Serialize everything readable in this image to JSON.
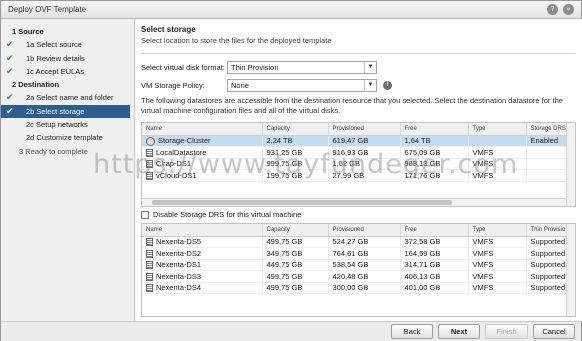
{
  "window": {
    "title": "Deploy OVF Template"
  },
  "sidebar": {
    "steps": [
      {
        "label": "1  Source",
        "kind": "head",
        "check": ""
      },
      {
        "label": "1a  Select source",
        "kind": "sub",
        "check": "✔"
      },
      {
        "label": "1b  Review details",
        "kind": "sub",
        "check": "✔"
      },
      {
        "label": "1c  Accept EULAs",
        "kind": "sub",
        "check": "✔"
      },
      {
        "label": "2  Destination",
        "kind": "head",
        "check": ""
      },
      {
        "label": "2a  Select name and folder",
        "kind": "sub",
        "check": "✔"
      },
      {
        "label": "2b  Select storage",
        "kind": "sub active",
        "check": "✔"
      },
      {
        "label": "2c  Setup networks",
        "kind": "sub",
        "check": ""
      },
      {
        "label": "2d  Customize template",
        "kind": "sub",
        "check": ""
      },
      {
        "label": "3  Ready to complete",
        "kind": "plain muted",
        "check": ""
      }
    ]
  },
  "main": {
    "title": "Select storage",
    "subtitle": "Select location to store the files for the deployed template",
    "disk_format_label": "Select virtual disk format:",
    "disk_format_value": "Thin Provision",
    "policy_label": "VM Storage Policy:",
    "policy_value": "None",
    "description": "The following datastores are accessible from the destination resource that you selected. Select the destination datastore for the virtual machine configuration files and all of the virtual disks."
  },
  "top_table": {
    "columns": [
      "Name",
      "Capacity",
      "Provisioned",
      "Free",
      "Type",
      "Storage DRS"
    ],
    "rows": [
      {
        "icon": "cluster",
        "name": "Storage-Cluster",
        "capacity": "2,24 TB",
        "provisioned": "619,47 GB",
        "free": "1,64 TB",
        "type": "",
        "drs": "Enabled"
      },
      {
        "icon": "datastore",
        "name": "LocalDatastore",
        "capacity": "931,25 GB",
        "provisioned": "916,93 GB",
        "free": "675,09 GB",
        "type": "VMFS",
        "drs": ""
      },
      {
        "icon": "datastore",
        "name": "Clrap-DS1",
        "capacity": "999,75 GB",
        "provisioned": "1,62 GB",
        "free": "988,13 GB",
        "type": "VMFS",
        "drs": ""
      },
      {
        "icon": "datastore",
        "name": "vCloud-DS1",
        "capacity": "199,75 GB",
        "provisioned": "27,99 GB",
        "free": "171,76 GB",
        "type": "VMFS",
        "drs": ""
      }
    ]
  },
  "drs_checkbox_label": "Disable Storage DRS for this virtual machine",
  "bottom_table": {
    "columns": [
      "Name",
      "Capacity",
      "Provisioned",
      "Free",
      "Type",
      "Thin Provisio"
    ],
    "rows": [
      {
        "name": "Nexenta-DS5",
        "capacity": "499,75 GB",
        "provisioned": "524,27 GB",
        "free": "372,58 GB",
        "type": "VMFS",
        "thin": "Supported"
      },
      {
        "name": "Nexenta-DS2",
        "capacity": "349,75 GB",
        "provisioned": "764,61 GB",
        "free": "164,59 GB",
        "type": "VMFS",
        "thin": "Supported"
      },
      {
        "name": "Nexenta-DS1",
        "capacity": "449,75 GB",
        "provisioned": "538,54 GB",
        "free": "314,71 GB",
        "type": "VMFS",
        "thin": "Supported"
      },
      {
        "name": "Nexenta-DS3",
        "capacity": "499,75 GB",
        "provisioned": "420,48 GB",
        "free": "406,13 GB",
        "type": "VMFS",
        "thin": "Supported"
      },
      {
        "name": "Nexenta-DS4",
        "capacity": "499,75 GB",
        "provisioned": "300,00 GB",
        "free": "401,00 GB",
        "type": "VMFS",
        "thin": "Supported"
      }
    ]
  },
  "buttons": {
    "back": "Back",
    "next": "Next",
    "finish": "Finish",
    "cancel": "Cancel"
  },
  "watermark": "https://www.tayfundeger.com",
  "colors": {
    "selection": "#2d5e92",
    "row_selected": "#c3dcf2",
    "check": "#3d8c3d"
  }
}
